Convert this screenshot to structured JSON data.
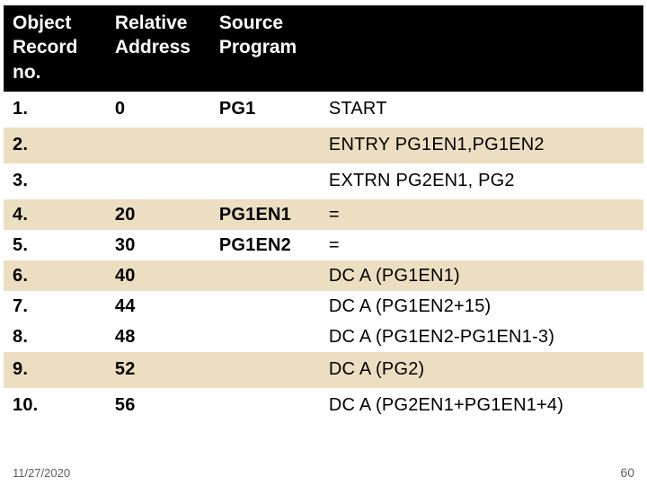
{
  "headers": {
    "col1": "Object Record no.",
    "col2": "Relative Address",
    "col3": "Source Program",
    "col4": ""
  },
  "rows": [
    {
      "no": "1.",
      "addr": "0",
      "src": "PG1",
      "text": "START",
      "band": "white"
    },
    {
      "no": "2.",
      "addr": "",
      "src": "",
      "text": "ENTRY PG1EN1,PG1EN2",
      "band": "tan"
    },
    {
      "no": "3.",
      "addr": "",
      "src": "",
      "text": "EXTRN PG2EN1, PG2",
      "band": "white"
    },
    {
      "no": "4.",
      "addr": "20",
      "src": "PG1EN1",
      "text": "=",
      "band": "tan"
    },
    {
      "no": "5.",
      "addr": "30",
      "src": "PG1EN2",
      "text": "=",
      "band": "white"
    },
    {
      "no": "6.",
      "addr": "40",
      "src": "",
      "text": "DC    A    (PG1EN1)",
      "band": "tan"
    },
    {
      "no": "7.",
      "addr": "44",
      "src": "",
      "text": "DC     A    (PG1EN2+15)",
      "band": "white"
    },
    {
      "no": "8.",
      "addr": "48",
      "src": "",
      "text": "DC     A    (PG1EN2-PG1EN1-3)",
      "band": "white"
    },
    {
      "no": "9.",
      "addr": "52",
      "src": "",
      "text": "DC      A     (PG2)",
      "band": "tan"
    },
    {
      "no": "10.",
      "addr": "56",
      "src": "",
      "text": "DC     A   (PG2EN1+PG1EN1+4)",
      "band": "white"
    }
  ],
  "footer": {
    "date": "11/27/2020",
    "page": "60"
  }
}
